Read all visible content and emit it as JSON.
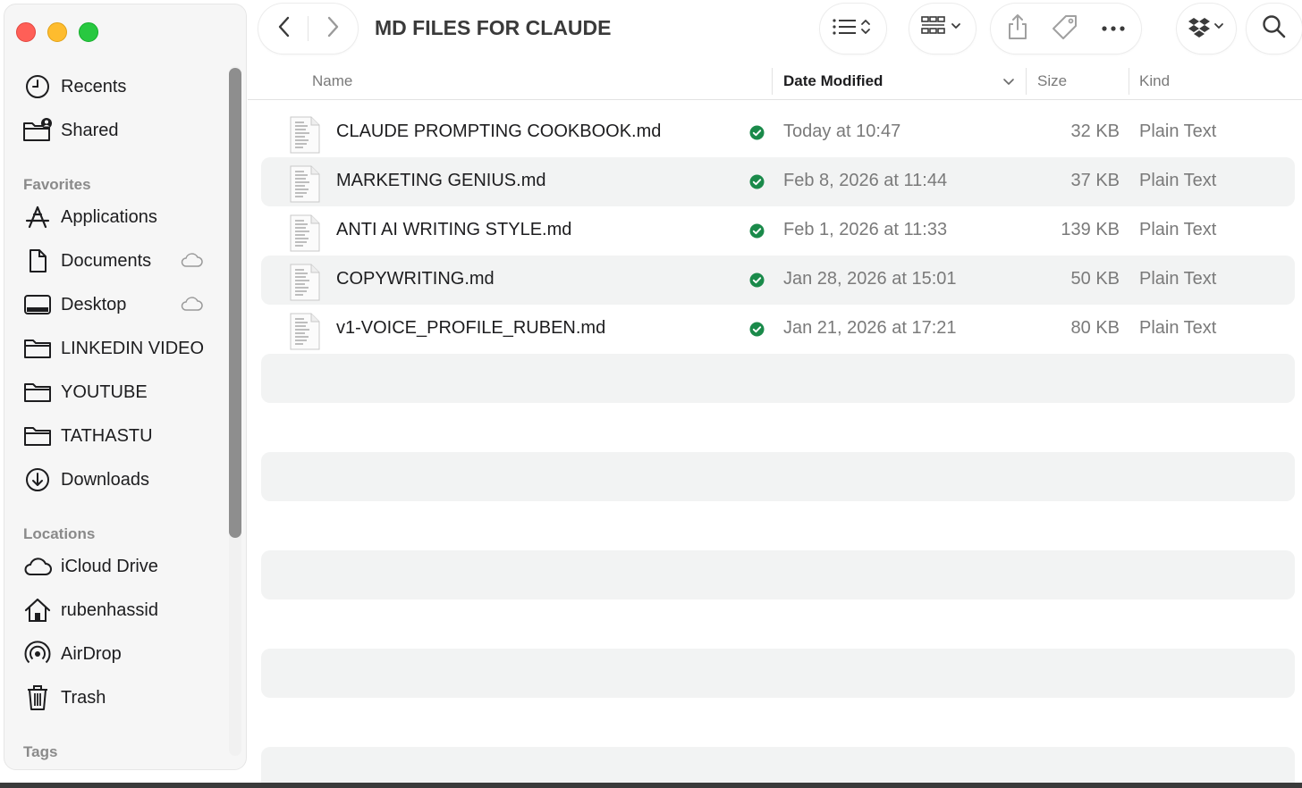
{
  "window": {
    "title": "MD FILES FOR CLAUDE"
  },
  "sidebar": {
    "top_items": [
      {
        "label": "Recents",
        "icon": "clock-icon"
      },
      {
        "label": "Shared",
        "icon": "shared-folder-icon"
      }
    ],
    "favorites_header": "Favorites",
    "favorites": [
      {
        "label": "Applications",
        "icon": "applications-icon"
      },
      {
        "label": "Documents",
        "icon": "document-icon",
        "cloud": true
      },
      {
        "label": "Desktop",
        "icon": "desktop-icon",
        "cloud": true
      },
      {
        "label": "LINKEDIN VIDEO",
        "icon": "folder-icon"
      },
      {
        "label": "YOUTUBE",
        "icon": "folder-icon"
      },
      {
        "label": "TATHASTU",
        "icon": "folder-icon"
      },
      {
        "label": "Downloads",
        "icon": "download-icon"
      }
    ],
    "locations_header": "Locations",
    "locations": [
      {
        "label": "iCloud Drive",
        "icon": "cloud-icon"
      },
      {
        "label": "rubenhassid",
        "icon": "home-icon"
      },
      {
        "label": "AirDrop",
        "icon": "airdrop-icon"
      },
      {
        "label": "Trash",
        "icon": "trash-icon"
      }
    ],
    "tags_header": "Tags"
  },
  "toolbar": {
    "icons": [
      "back-icon",
      "forward-icon",
      "list-view-icon",
      "grid-view-icon",
      "share-icon",
      "tag-icon",
      "more-icon",
      "dropbox-icon",
      "search-icon"
    ]
  },
  "columns": {
    "name": "Name",
    "date": "Date Modified",
    "size": "Size",
    "kind": "Kind"
  },
  "files": [
    {
      "name": "CLAUDE PROMPTING COOKBOOK.md",
      "date": "Today at 10:47",
      "size": "32 KB",
      "kind": "Plain Text"
    },
    {
      "name": "MARKETING GENIUS.md",
      "date": "Feb 8, 2026 at 11:44",
      "size": "37 KB",
      "kind": "Plain Text"
    },
    {
      "name": "ANTI AI WRITING STYLE.md",
      "date": "Feb 1, 2026 at 11:33",
      "size": "139 KB",
      "kind": "Plain Text"
    },
    {
      "name": "COPYWRITING.md",
      "date": "Jan 28, 2026 at 15:01",
      "size": "50 KB",
      "kind": "Plain Text"
    },
    {
      "name": "v1-VOICE_PROFILE_RUBEN.md",
      "date": "Jan 21, 2026 at 17:21",
      "size": "80 KB",
      "kind": "Plain Text"
    }
  ],
  "colors": {
    "sync_green": "#1a8a4a",
    "close": "#ff5f57",
    "minimize": "#febc2e",
    "zoom": "#28c840"
  }
}
